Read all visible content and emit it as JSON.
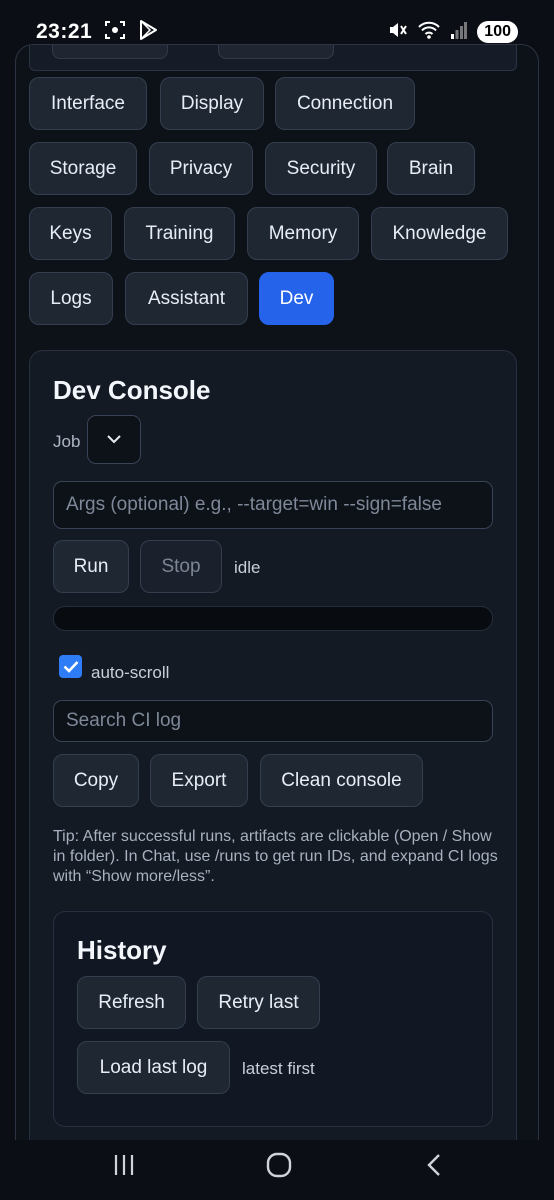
{
  "status_bar": {
    "time": "23:21",
    "battery": "100",
    "icons": [
      "screenshot-icon",
      "play-store-icon",
      "mute-icon",
      "wifi-icon",
      "signal-icon"
    ]
  },
  "tabs": [
    {
      "label": "Interface",
      "active": false
    },
    {
      "label": "Display",
      "active": false
    },
    {
      "label": "Connection",
      "active": false
    },
    {
      "label": "Storage",
      "active": false
    },
    {
      "label": "Privacy",
      "active": false
    },
    {
      "label": "Security",
      "active": false
    },
    {
      "label": "Brain",
      "active": false
    },
    {
      "label": "Keys",
      "active": false
    },
    {
      "label": "Training",
      "active": false
    },
    {
      "label": "Memory",
      "active": false
    },
    {
      "label": "Knowledge",
      "active": false
    },
    {
      "label": "Logs",
      "active": false
    },
    {
      "label": "Assistant",
      "active": false
    },
    {
      "label": "Dev",
      "active": true
    }
  ],
  "dev_console": {
    "title": "Dev Console",
    "job_label": "Job",
    "job_value": "",
    "args_placeholder": "Args (optional) e.g., --target=win --sign=false",
    "run_label": "Run",
    "stop_label": "Stop",
    "status": "idle",
    "progress": 0,
    "autoscroll_label": "auto-scroll",
    "autoscroll_checked": true,
    "search_placeholder": "Search CI log",
    "copy_label": "Copy",
    "export_label": "Export",
    "clean_label": "Clean console",
    "tip": "Tip: After successful runs, artifacts are clickable (Open / Show in folder). In Chat, use /runs to get run IDs, and expand CI logs with “Show more/less”."
  },
  "history": {
    "title": "History",
    "refresh_label": "Refresh",
    "retry_label": "Retry last",
    "load_label": "Load last log",
    "order_note": "latest first"
  },
  "colors": {
    "accent": "#2563eb",
    "background": "#0b0f15",
    "card": "#141a24"
  }
}
